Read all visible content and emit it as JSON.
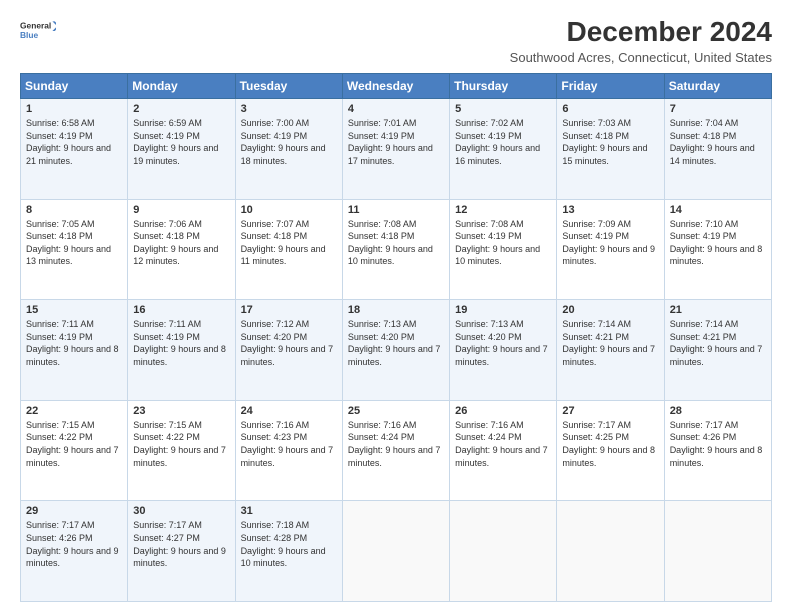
{
  "header": {
    "logo_line1": "General",
    "logo_line2": "Blue",
    "title": "December 2024",
    "subtitle": "Southwood Acres, Connecticut, United States"
  },
  "days_of_week": [
    "Sunday",
    "Monday",
    "Tuesday",
    "Wednesday",
    "Thursday",
    "Friday",
    "Saturday"
  ],
  "weeks": [
    [
      {
        "day": "1",
        "sunrise": "Sunrise: 6:58 AM",
        "sunset": "Sunset: 4:19 PM",
        "daylight": "Daylight: 9 hours and 21 minutes."
      },
      {
        "day": "2",
        "sunrise": "Sunrise: 6:59 AM",
        "sunset": "Sunset: 4:19 PM",
        "daylight": "Daylight: 9 hours and 19 minutes."
      },
      {
        "day": "3",
        "sunrise": "Sunrise: 7:00 AM",
        "sunset": "Sunset: 4:19 PM",
        "daylight": "Daylight: 9 hours and 18 minutes."
      },
      {
        "day": "4",
        "sunrise": "Sunrise: 7:01 AM",
        "sunset": "Sunset: 4:19 PM",
        "daylight": "Daylight: 9 hours and 17 minutes."
      },
      {
        "day": "5",
        "sunrise": "Sunrise: 7:02 AM",
        "sunset": "Sunset: 4:19 PM",
        "daylight": "Daylight: 9 hours and 16 minutes."
      },
      {
        "day": "6",
        "sunrise": "Sunrise: 7:03 AM",
        "sunset": "Sunset: 4:18 PM",
        "daylight": "Daylight: 9 hours and 15 minutes."
      },
      {
        "day": "7",
        "sunrise": "Sunrise: 7:04 AM",
        "sunset": "Sunset: 4:18 PM",
        "daylight": "Daylight: 9 hours and 14 minutes."
      }
    ],
    [
      {
        "day": "8",
        "sunrise": "Sunrise: 7:05 AM",
        "sunset": "Sunset: 4:18 PM",
        "daylight": "Daylight: 9 hours and 13 minutes."
      },
      {
        "day": "9",
        "sunrise": "Sunrise: 7:06 AM",
        "sunset": "Sunset: 4:18 PM",
        "daylight": "Daylight: 9 hours and 12 minutes."
      },
      {
        "day": "10",
        "sunrise": "Sunrise: 7:07 AM",
        "sunset": "Sunset: 4:18 PM",
        "daylight": "Daylight: 9 hours and 11 minutes."
      },
      {
        "day": "11",
        "sunrise": "Sunrise: 7:08 AM",
        "sunset": "Sunset: 4:18 PM",
        "daylight": "Daylight: 9 hours and 10 minutes."
      },
      {
        "day": "12",
        "sunrise": "Sunrise: 7:08 AM",
        "sunset": "Sunset: 4:19 PM",
        "daylight": "Daylight: 9 hours and 10 minutes."
      },
      {
        "day": "13",
        "sunrise": "Sunrise: 7:09 AM",
        "sunset": "Sunset: 4:19 PM",
        "daylight": "Daylight: 9 hours and 9 minutes."
      },
      {
        "day": "14",
        "sunrise": "Sunrise: 7:10 AM",
        "sunset": "Sunset: 4:19 PM",
        "daylight": "Daylight: 9 hours and 8 minutes."
      }
    ],
    [
      {
        "day": "15",
        "sunrise": "Sunrise: 7:11 AM",
        "sunset": "Sunset: 4:19 PM",
        "daylight": "Daylight: 9 hours and 8 minutes."
      },
      {
        "day": "16",
        "sunrise": "Sunrise: 7:11 AM",
        "sunset": "Sunset: 4:19 PM",
        "daylight": "Daylight: 9 hours and 8 minutes."
      },
      {
        "day": "17",
        "sunrise": "Sunrise: 7:12 AM",
        "sunset": "Sunset: 4:20 PM",
        "daylight": "Daylight: 9 hours and 7 minutes."
      },
      {
        "day": "18",
        "sunrise": "Sunrise: 7:13 AM",
        "sunset": "Sunset: 4:20 PM",
        "daylight": "Daylight: 9 hours and 7 minutes."
      },
      {
        "day": "19",
        "sunrise": "Sunrise: 7:13 AM",
        "sunset": "Sunset: 4:20 PM",
        "daylight": "Daylight: 9 hours and 7 minutes."
      },
      {
        "day": "20",
        "sunrise": "Sunrise: 7:14 AM",
        "sunset": "Sunset: 4:21 PM",
        "daylight": "Daylight: 9 hours and 7 minutes."
      },
      {
        "day": "21",
        "sunrise": "Sunrise: 7:14 AM",
        "sunset": "Sunset: 4:21 PM",
        "daylight": "Daylight: 9 hours and 7 minutes."
      }
    ],
    [
      {
        "day": "22",
        "sunrise": "Sunrise: 7:15 AM",
        "sunset": "Sunset: 4:22 PM",
        "daylight": "Daylight: 9 hours and 7 minutes."
      },
      {
        "day": "23",
        "sunrise": "Sunrise: 7:15 AM",
        "sunset": "Sunset: 4:22 PM",
        "daylight": "Daylight: 9 hours and 7 minutes."
      },
      {
        "day": "24",
        "sunrise": "Sunrise: 7:16 AM",
        "sunset": "Sunset: 4:23 PM",
        "daylight": "Daylight: 9 hours and 7 minutes."
      },
      {
        "day": "25",
        "sunrise": "Sunrise: 7:16 AM",
        "sunset": "Sunset: 4:24 PM",
        "daylight": "Daylight: 9 hours and 7 minutes."
      },
      {
        "day": "26",
        "sunrise": "Sunrise: 7:16 AM",
        "sunset": "Sunset: 4:24 PM",
        "daylight": "Daylight: 9 hours and 7 minutes."
      },
      {
        "day": "27",
        "sunrise": "Sunrise: 7:17 AM",
        "sunset": "Sunset: 4:25 PM",
        "daylight": "Daylight: 9 hours and 8 minutes."
      },
      {
        "day": "28",
        "sunrise": "Sunrise: 7:17 AM",
        "sunset": "Sunset: 4:26 PM",
        "daylight": "Daylight: 9 hours and 8 minutes."
      }
    ],
    [
      {
        "day": "29",
        "sunrise": "Sunrise: 7:17 AM",
        "sunset": "Sunset: 4:26 PM",
        "daylight": "Daylight: 9 hours and 9 minutes."
      },
      {
        "day": "30",
        "sunrise": "Sunrise: 7:17 AM",
        "sunset": "Sunset: 4:27 PM",
        "daylight": "Daylight: 9 hours and 9 minutes."
      },
      {
        "day": "31",
        "sunrise": "Sunrise: 7:18 AM",
        "sunset": "Sunset: 4:28 PM",
        "daylight": "Daylight: 9 hours and 10 minutes."
      },
      null,
      null,
      null,
      null
    ]
  ]
}
